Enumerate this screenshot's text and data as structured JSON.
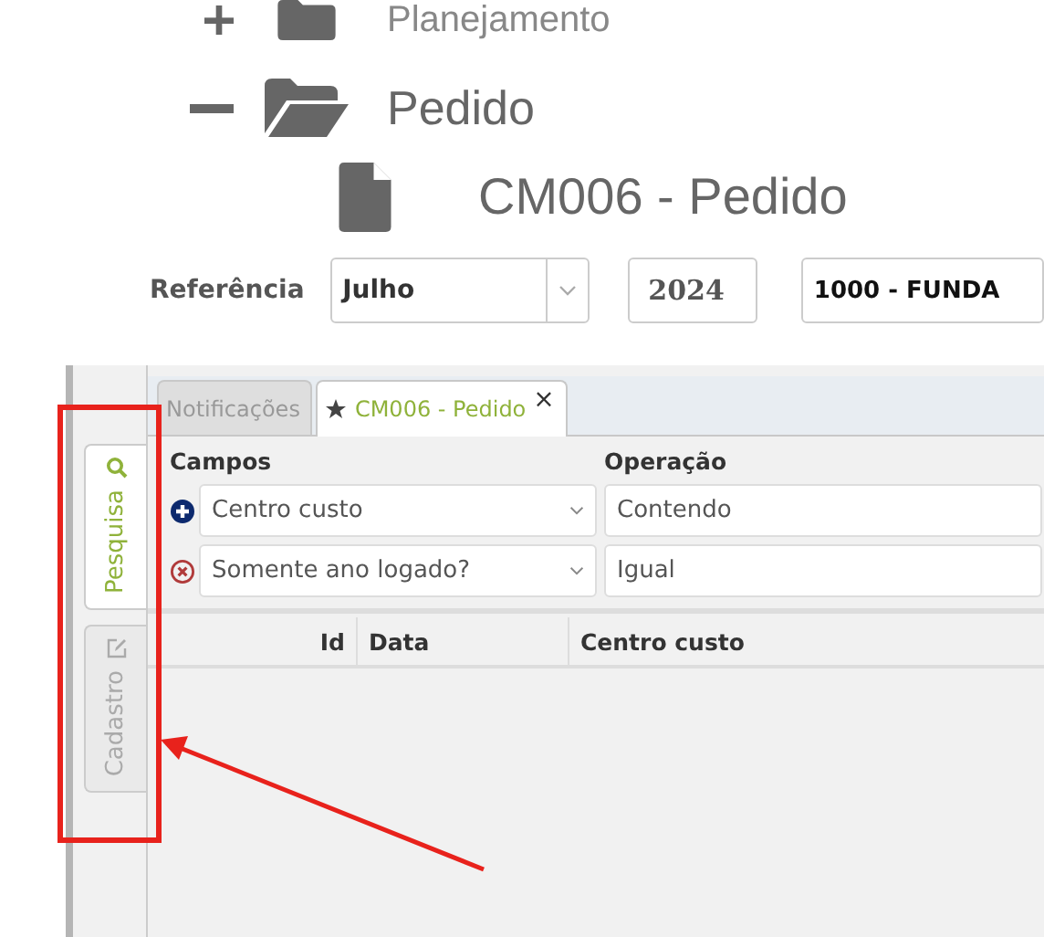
{
  "tree": [
    {
      "label": "Planejamento",
      "expanded": false
    },
    {
      "label": "Pedido",
      "expanded": true,
      "children": [
        {
          "label": "CM006 - Pedido"
        }
      ]
    }
  ],
  "filter_bar": {
    "label": "Referência",
    "month": "Julho",
    "year": "2024",
    "company": "1000 - FUNDA"
  },
  "side_tabs": [
    {
      "label": "Pesquisa",
      "kind": "search",
      "selected": true
    },
    {
      "label": "Cadastro",
      "kind": "edit",
      "selected": false
    }
  ],
  "tabs": [
    {
      "label": "Notificações",
      "selected": false,
      "pinned": false,
      "closable": false
    },
    {
      "label": "CM006 - Pedido",
      "selected": true,
      "pinned": true,
      "closable": true,
      "close": "×"
    }
  ],
  "filters": {
    "fields_label": "Campos",
    "operation_label": "Operação",
    "rows": [
      {
        "kind": "add",
        "field": "Centro custo",
        "operation": "Contendo"
      },
      {
        "kind": "remove",
        "field": "Somente ano logado?",
        "operation": "Igual"
      }
    ]
  },
  "table": {
    "columns": [
      "Id",
      "Data",
      "Centro custo"
    ]
  }
}
